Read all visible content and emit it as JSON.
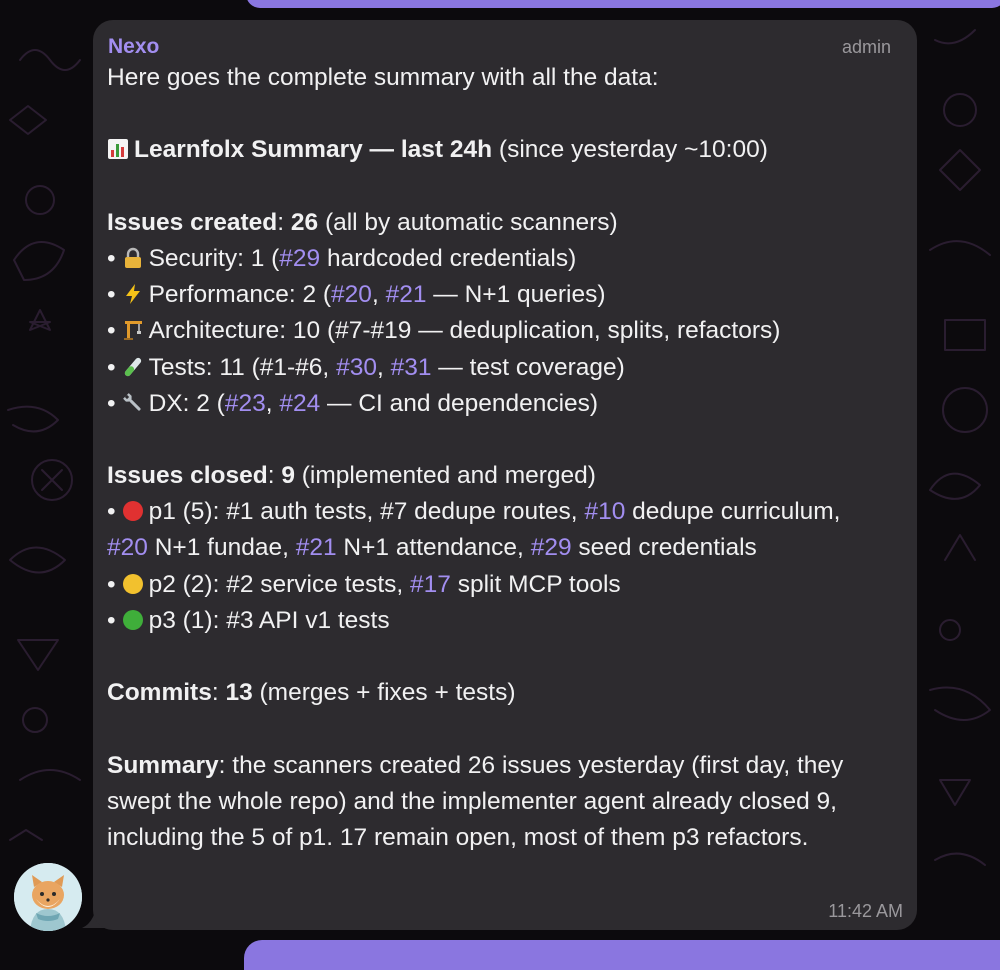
{
  "message": {
    "sender": "Nexo",
    "role": "admin",
    "time": "11:42 AM",
    "intro": "Here goes the complete summary with all the data:",
    "title": {
      "icon": "bar-chart-emoji",
      "bold": "Learnfolx Summary — last 24h",
      "rest": " (since yesterday ~10:00)"
    },
    "issues_created": {
      "label": "Issues created",
      "colon": ":",
      "count": "26",
      "note": " (all by automatic scanners)",
      "items": [
        {
          "icon": "lock-emoji",
          "text_before": "Security: 1 (",
          "link1": "#29",
          "text_after": " hardcoded credentials)"
        },
        {
          "icon": "lightning-emoji",
          "text_before": "Performance: 2 (",
          "link1": "#20",
          "sep": ", ",
          "link2": "#21",
          "text_after": " — N+1 queries)"
        },
        {
          "icon": "construction-crane-emoji",
          "text": "Architecture: 10 (#7-#19 — deduplication, splits, refactors)"
        },
        {
          "icon": "test-tube-emoji",
          "text_before": "Tests: 11 (#1-#6, ",
          "link1": "#30",
          "sep": ", ",
          "link2": "#31",
          "text_after": " — test coverage)"
        },
        {
          "icon": "wrench-emoji",
          "text_before": "DX: 2 (",
          "link1": "#23",
          "sep": ", ",
          "link2": "#24",
          "text_after": " — CI and dependencies)"
        }
      ]
    },
    "issues_closed": {
      "label": "Issues closed",
      "colon": ":",
      "count": "9",
      "note": " (implemented and merged)",
      "p1": {
        "icon": "red-circle-emoji",
        "t1": "p1 (5): #1 auth tests, #7 dedupe routes, ",
        "l1": "#10",
        "t2": " dedupe curriculum, ",
        "l2": "#20",
        "t3": " N+1 fundae, ",
        "l3": "#21",
        "t4": " N+1 attendance, ",
        "l4": "#29",
        "t5": " seed credentials"
      },
      "p2": {
        "icon": "yellow-circle-emoji",
        "t1": "p2 (2): #2 service tests, ",
        "l1": "#17",
        "t2": " split MCP tools"
      },
      "p3": {
        "icon": "green-circle-emoji",
        "t1": "p3 (1): #3 API v1 tests"
      }
    },
    "commits": {
      "label": "Commits",
      "colon": ":",
      "count": "13",
      "note": " (merges + fixes + tests)"
    },
    "summary": {
      "label": "Summary",
      "colon": ":",
      "text": " the scanners created 26 issues yesterday (first day, they swept the whole repo) and the implementer agent already closed 9, including the 5 of p1. 17 remain open, most of them p3 refactors."
    }
  },
  "avatar": {
    "icon": "fox-avatar-icon"
  },
  "colors": {
    "background": "#0c0a0d",
    "bubble": "#2d2b2f",
    "text": "#f1f1f2",
    "link": "#a28ef0",
    "muted": "#9a989c",
    "accent_bubble": "#8a76e0"
  }
}
